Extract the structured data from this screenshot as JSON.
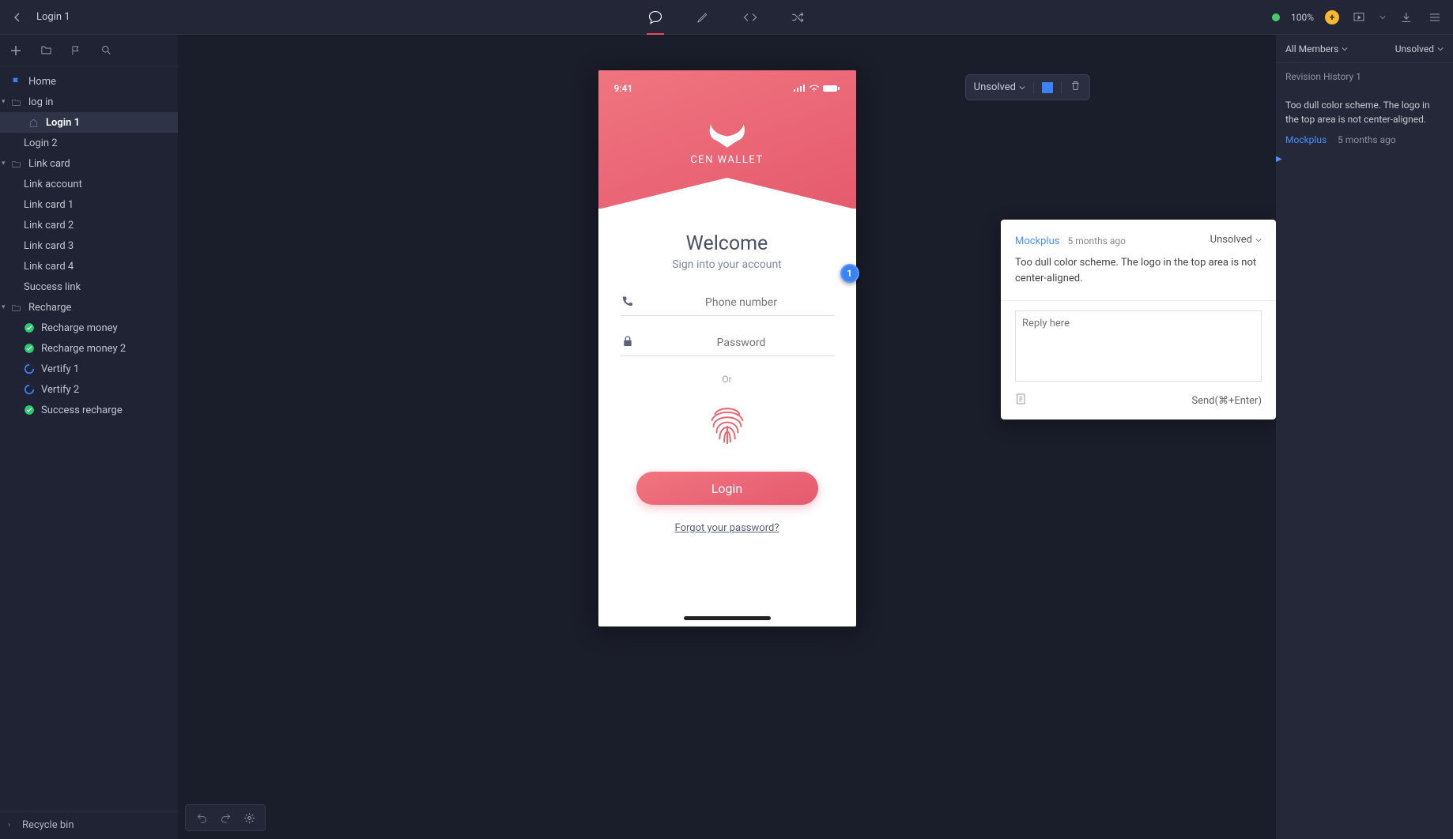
{
  "topbar": {
    "page_title": "Login 1",
    "zoom": "100%"
  },
  "tree": {
    "home": "Home",
    "login_folder": "log in",
    "login1": "Login 1",
    "login2": "Login 2",
    "linkcard_folder": "Link card",
    "linkaccount": "Link account",
    "linkcard1": "Link card 1",
    "linkcard2": "Link card 2",
    "linkcard3": "Link card 3",
    "linkcard4": "Link card 4",
    "successlink": "Success link",
    "recharge_folder": "Recharge",
    "rechargemoney": "Recharge money",
    "rechargemoney2": "Recharge money 2",
    "vertify1": "Vertify 1",
    "vertify2": "Vertify 2",
    "successrecharge": "Success recharge",
    "recycle": "Recycle bin"
  },
  "statusbar": {
    "unsolved": "Unsolved"
  },
  "phone": {
    "time": "9:41",
    "brand": "CEN WALLET",
    "welcome": "Welcome",
    "subtitle": "Sign into your account",
    "phone_ph": "Phone number",
    "pass_ph": "Password",
    "or": "Or",
    "login": "Login",
    "forgot": "Forgot your password?"
  },
  "pin": {
    "num": "1"
  },
  "comment": {
    "author": "Mockplus",
    "time": "5 months ago",
    "status": "Unsolved",
    "text": "Too dull color scheme. The logo in the top area is not center-aligned.",
    "reply_ph": "Reply here",
    "send": "Send(⌘+Enter)"
  },
  "rightpanel": {
    "members": "All Members",
    "unsolved": "Unsolved",
    "revision": "Revision History 1",
    "item_text": "Too dull color scheme. The logo in the top area is not center-aligned.",
    "item_author": "Mockplus",
    "item_time": "5 months ago"
  }
}
